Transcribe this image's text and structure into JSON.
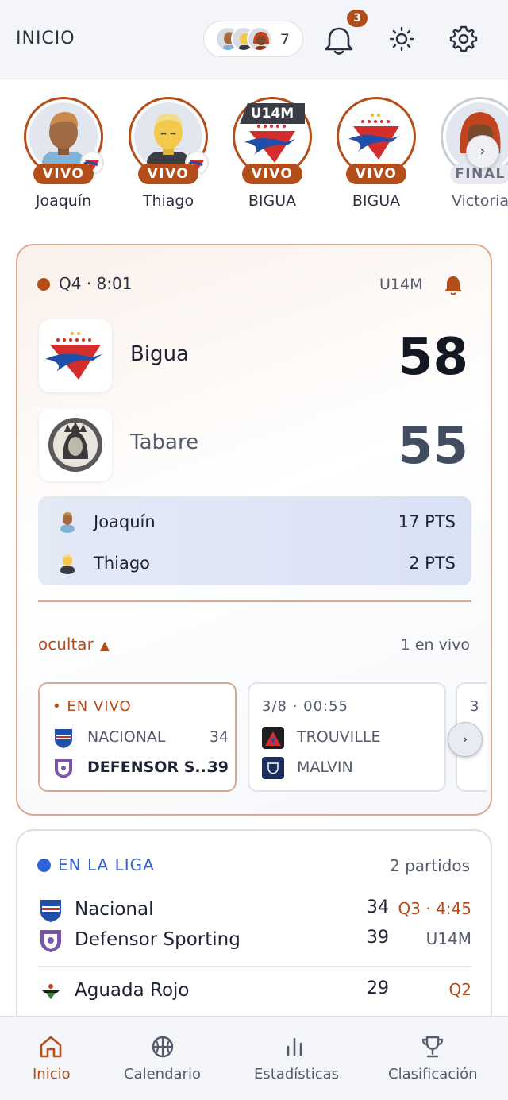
{
  "header": {
    "title": "INICIO",
    "following_count": "7",
    "notifications_badge": "3"
  },
  "stories": [
    {
      "name": "Joaquín",
      "status": "VIVO",
      "kind": "player"
    },
    {
      "name": "Thiago",
      "status": "VIVO",
      "kind": "player"
    },
    {
      "name": "BIGUA",
      "status": "VIVO",
      "tag": "U14M",
      "kind": "team"
    },
    {
      "name": "BIGUA",
      "status": "VIVO",
      "kind": "team"
    },
    {
      "name": "Victoria",
      "status": "FINAL",
      "kind": "player"
    }
  ],
  "game": {
    "status": "Q4 · 8:01",
    "category": "U14M",
    "home": {
      "name": "Bigua",
      "score": "58"
    },
    "away": {
      "name": "Tabare",
      "score": "55"
    },
    "players": [
      {
        "name": "Joaquín",
        "points": "17 PTS"
      },
      {
        "name": "Thiago",
        "points": "2 PTS"
      }
    ],
    "toggle_label": "ocultar",
    "live_count": "1 en vivo",
    "mini_games": [
      {
        "header": "• EN VIVO",
        "teams": [
          {
            "name": "NACIONAL",
            "score": "34"
          },
          {
            "name": "DEFENSOR S...",
            "score": "39"
          }
        ]
      },
      {
        "header": "3/8 · 00:55",
        "teams": [
          {
            "name": "TROUVILLE",
            "score": ""
          },
          {
            "name": "MALVIN",
            "score": ""
          }
        ]
      }
    ],
    "peek_header": "3"
  },
  "league": {
    "title": "EN LA LIGA",
    "count": "2 partidos",
    "games": [
      {
        "home": "Nacional",
        "home_score": "34",
        "away": "Defensor Sporting",
        "away_score": "39",
        "period": "Q3 · 4:45",
        "category": "U14M"
      },
      {
        "home": "Aguada Rojo",
        "home_score": "29",
        "period": "Q2"
      }
    ]
  },
  "nav": {
    "items": [
      {
        "label": "Inicio",
        "active": true
      },
      {
        "label": "Calendario"
      },
      {
        "label": "Estadísticas"
      },
      {
        "label": "Clasificación"
      }
    ]
  },
  "colors": {
    "accent": "#b34e1a",
    "league": "#2e63d8",
    "text": "#1e2333",
    "muted": "#555b6b"
  }
}
